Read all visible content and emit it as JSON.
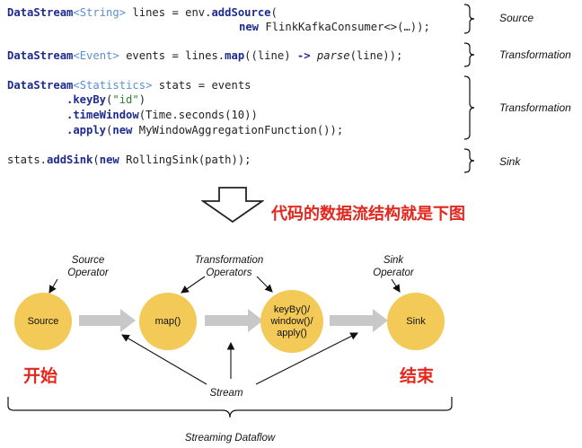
{
  "code": {
    "line1": {
      "type": "DataStream",
      "generic": "<String>",
      "rest": " lines = env.",
      "method": "addSource",
      "tail": "("
    },
    "line2": {
      "kw": "new",
      "rest": " FlinkKafkaConsumer<>(…));"
    },
    "line3": {
      "type": "DataStream",
      "generic": "<Event>",
      "rest": " events = lines.",
      "method": "map",
      "mid": "((line) ",
      "arrow": "->",
      "fn": "parse",
      "tail": "(line));"
    },
    "line4": {
      "type": "DataStream",
      "generic": "<Statistics>",
      "rest": " stats = events"
    },
    "line5": {
      "method": ".keyBy",
      "open": "(",
      "str": "\"id\"",
      "close": ")"
    },
    "line6": {
      "method": ".timeWindow",
      "tail": "(Time.seconds(10))"
    },
    "line7": {
      "method": ".apply",
      "open": "(",
      "kw": "new",
      "tail": " MyWindowAggregationFunction());"
    },
    "line8": {
      "pre": "stats.",
      "method": "addSink",
      "open": "(",
      "kw": "new",
      "tail": " RollingSink(path));"
    }
  },
  "labels": {
    "source": "Source",
    "transformation1": "Transformation",
    "transformation2": "Transformation",
    "sink": "Sink"
  },
  "caption": "代码的数据流结构就是下图",
  "diagram": {
    "source_operator": [
      "Source",
      "Operator"
    ],
    "transformation_operators": [
      "Transformation",
      "Operators"
    ],
    "sink_operator": [
      "Sink",
      "Operator"
    ],
    "nodes": {
      "source": "Source",
      "map": "map()",
      "keyby": [
        "keyBy()/",
        "window()/",
        "apply()"
      ],
      "sink": "Sink"
    },
    "start": "开始",
    "end": "结束",
    "stream": "Stream",
    "streaming_dataflow": "Streaming Dataflow"
  },
  "colors": {
    "node": "#f3ca57",
    "accent_red": "#e4261c",
    "keyword": "#1d2b8f",
    "generic": "#5b8fd0",
    "flow_arrow": "#c8c8c8"
  }
}
